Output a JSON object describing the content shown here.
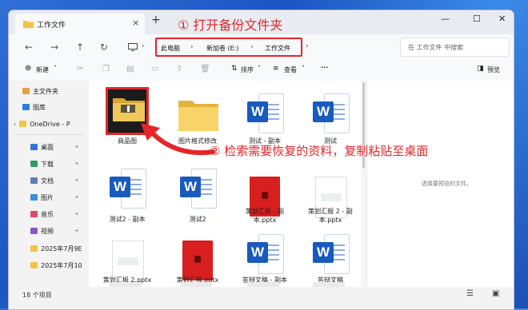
{
  "window": {
    "tab_title": "工作文件",
    "tab_close": "×",
    "new_tab": "+",
    "minimize": "—",
    "maximize": "☐",
    "close": "✕"
  },
  "nav": {
    "back": "←",
    "forward": "→",
    "up": "↑",
    "refresh": "↻",
    "monitor_icon": "monitor-icon",
    "breadcrumb": [
      "此电脑",
      "新加卷 (E:)",
      "工作文件"
    ],
    "search_placeholder": "在 工作文件 中搜索"
  },
  "toolbar": {
    "new_label": "新建",
    "sort_label": "排序",
    "view_label": "查看",
    "more_label": "···",
    "preview_label": "预览"
  },
  "sidebar": {
    "items": [
      {
        "label": "主文件夹",
        "color": "#e8a33b"
      },
      {
        "label": "图库",
        "color": "#2a7de1"
      },
      {
        "label": "OneDrive - P",
        "color": "#1e88e5"
      },
      {
        "label": "桌面",
        "color": "#2f78d6"
      },
      {
        "label": "下载",
        "color": "#2a9d6b"
      },
      {
        "label": "文档",
        "color": "#5b7dba"
      },
      {
        "label": "图片",
        "color": "#3b8de0"
      },
      {
        "label": "音乐",
        "color": "#e04b64"
      },
      {
        "label": "视频",
        "color": "#8a55c9"
      },
      {
        "label": "2025年7月9E",
        "color": "#f2c244"
      },
      {
        "label": "2025年7月10",
        "color": "#f2c244"
      }
    ]
  },
  "files": [
    {
      "name": "商品图",
      "type": "folder-dark"
    },
    {
      "name": "图片格式修改",
      "type": "folder"
    },
    {
      "name": "测试 - 副本",
      "type": "word"
    },
    {
      "name": "测试",
      "type": "word"
    },
    {
      "name": "测试2 - 副本",
      "type": "word"
    },
    {
      "name": "测试2",
      "type": "word"
    },
    {
      "name": "策划汇报 - 副本.pptx",
      "type": "pptx"
    },
    {
      "name": "策划汇报 2 - 副本.pptx",
      "type": "blank"
    },
    {
      "name": "策划汇报 2.pptx",
      "type": "blank"
    },
    {
      "name": "策划汇报.pptx",
      "type": "pptx"
    },
    {
      "name": "答辩文稿 - 副本",
      "type": "word"
    },
    {
      "name": "答辩文稿",
      "type": "word"
    }
  ],
  "preview_text": "选择要预览的文件。",
  "status": "18 个项目",
  "annotations": {
    "step1": "① 打开备份文件夹",
    "step2": "② 检索需要恢复的资料，复制粘贴至桌面"
  },
  "accent_red": "#e4262a"
}
